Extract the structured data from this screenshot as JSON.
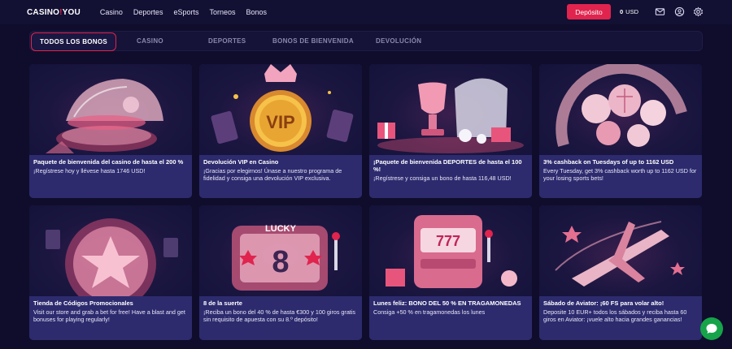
{
  "header": {
    "logo_left": "CASINO",
    "logo_mid": "!",
    "logo_right": "YOU",
    "nav": [
      "Casino",
      "Deportes",
      "eSports",
      "Torneos",
      "Bonos"
    ],
    "deposit_label": "Depósito",
    "balance": "0",
    "currency": "USD",
    "icons": [
      "mail-icon",
      "user-icon",
      "settings-icon"
    ]
  },
  "tabs": [
    "TODOS LOS BONOS",
    "CASINO",
    "DEPORTES",
    "BONOS DE BIENVENIDA",
    "DEVOLUCIÓN"
  ],
  "cards": [
    {
      "title": "Paquete de bienvenida del casino de hasta el 200 %",
      "desc": "¡Regístrese hoy y llévese hasta 1746 USD!",
      "art": "roulette-dome"
    },
    {
      "title": "Devolución VIP en Casino",
      "desc": "¡Gracias por elegirnos! Únase a nuestro programa de fidelidad y consiga una devolución VIP exclusiva.",
      "art": "vip-coin"
    },
    {
      "title": "¡Paquete de bienvenida DEPORTES de hasta el 100 %!",
      "desc": "¡Regístrese y consiga un bono de hasta 116,48 USD!",
      "art": "trophy-gifts"
    },
    {
      "title": "3% cashback on Tuesdays of up to 1162 USD",
      "desc": "Every Tuesday, get 3% cashback worth up to 1162 USD for your losing sports bets!",
      "art": "sports-balls"
    },
    {
      "title": "Tienda de Códigos Promocionales",
      "desc": "Visit our store and grab a bet for free! Have a blast and get bonuses for playing regularly!",
      "art": "star-chip"
    },
    {
      "title": "8 de la suerte",
      "desc": "¡Reciba un bono del 40 % de hasta €300 y 100 giros gratis sin requisito de apuesta con su 8.º depósito!",
      "art": "lucky-8-slot"
    },
    {
      "title": "Lunes feliz: BONO DEL 50 % EN TRAGAMONEDAS",
      "desc": "Consiga +50 % en tragamonedas los lunes",
      "art": "slot-machine"
    },
    {
      "title": "Sábado de Aviator: ¡60 FS para volar alto!",
      "desc": "Deposite 10 EUR+ todos los sábados y reciba hasta 60 giros en Aviator: ¡vuele alto hacia grandes ganancias!",
      "art": "aviator-plane"
    }
  ],
  "art_text": {
    "vip": "VIP",
    "lucky": "LUCKY",
    "eight": "8",
    "sevens": "777"
  },
  "colors": {
    "accent": "#e0244e",
    "card_body": "#2d2b6e",
    "background": "#0f0d2b",
    "chat": "#16a34a"
  }
}
